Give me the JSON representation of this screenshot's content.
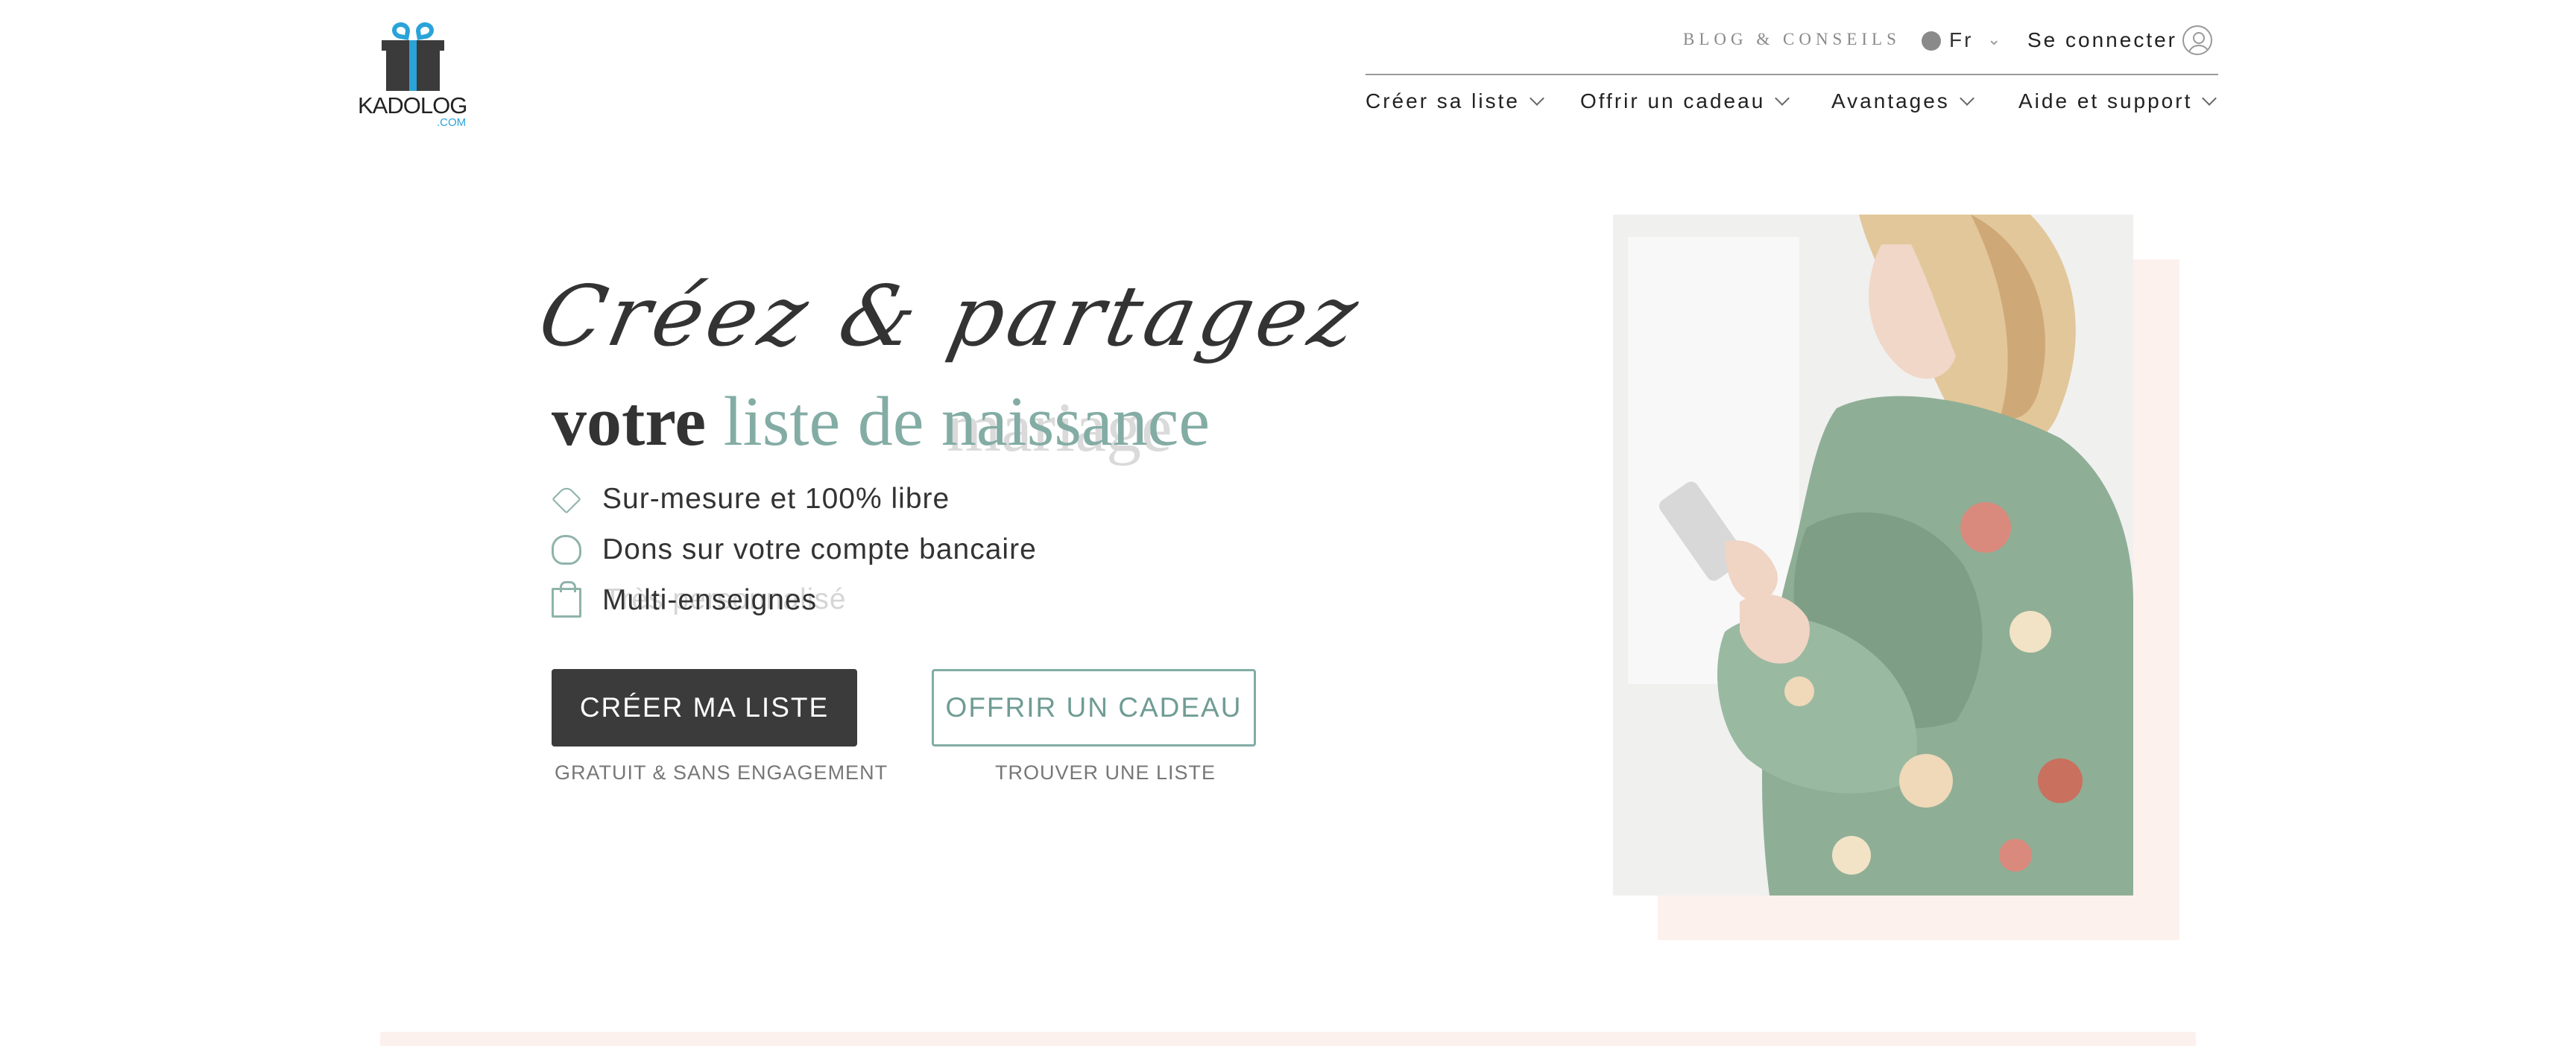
{
  "brand": {
    "name": "KADOLOG",
    "suffix": ".COM"
  },
  "topbar": {
    "blog": "BLOG & CONSEILS",
    "lang": "Fr",
    "login": "Se connecter"
  },
  "nav": [
    {
      "label": "Créer sa liste"
    },
    {
      "label": "Offrir un cadeau"
    },
    {
      "label": "Avantages"
    },
    {
      "label": "Aide et support"
    }
  ],
  "hero": {
    "script": "Créez & partagez",
    "title_strong": "votre",
    "title_accent": "liste de naissance",
    "ghost_accent": "mariage",
    "features": [
      {
        "icon": "tag-icon",
        "text": "Sur-mesure et 100% libre"
      },
      {
        "icon": "piggy-bank-icon",
        "text": "Dons sur votre compte bancaire"
      },
      {
        "icon": "shopping-bag-icon",
        "text": "Multi-enseignes"
      }
    ],
    "ghost_feature": "Très personnalisé",
    "cta_primary": "CRÉER MA LISTE",
    "cta_primary_sub": "GRATUIT & SANS ENGAGEMENT",
    "cta_secondary": "OFFRIR UN CADEAU",
    "cta_secondary_sub": "TROUVER UNE LISTE"
  },
  "colors": {
    "accent": "#83aca4",
    "dark": "#3b3b3b",
    "blush": "#fdf1ee",
    "brand_blue": "#2aa3d8"
  }
}
